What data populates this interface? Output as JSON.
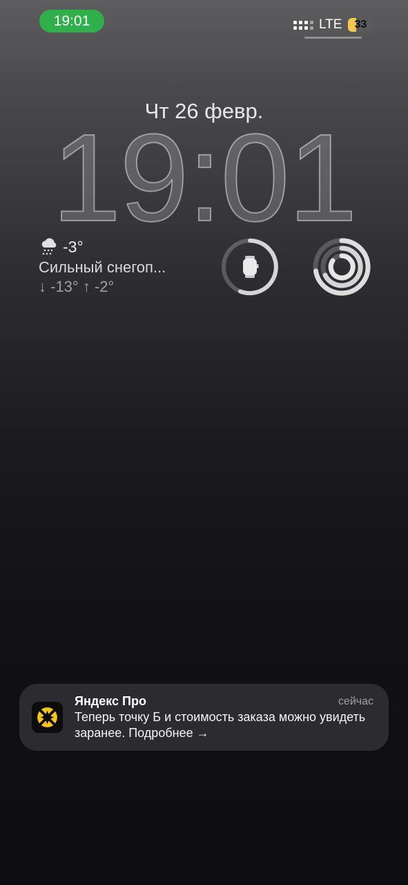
{
  "status_bar": {
    "time": "19:01",
    "network": "LTE",
    "battery_percent": "33",
    "battery_level": 0.33,
    "time_pill_color": "#30b04a",
    "battery_color": "#f2c94c"
  },
  "lock_screen": {
    "date": "Чт 26 февр.",
    "time": "19:01"
  },
  "weather_widget": {
    "icon": "snow-cloud-icon",
    "temperature": "-3°",
    "condition": "Сильный снегоп...",
    "low_high": "↓ -13° ↑ -2°"
  },
  "widgets": [
    {
      "name": "watch-battery-ring",
      "icon": "watch-icon"
    },
    {
      "name": "activity-rings",
      "icon": "activity-rings-icon"
    }
  ],
  "notification": {
    "app_name": "Яндекс Про",
    "time": "сейчас",
    "message": "Теперь точку Б и стоимость заказа можно увидеть заранее. Подробнее →",
    "icon": "yandex-pro-icon",
    "icon_accent": "#f5c518"
  }
}
